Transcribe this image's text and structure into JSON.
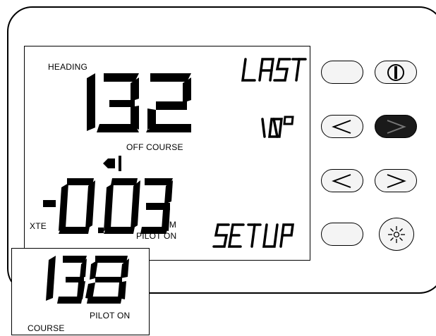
{
  "display": {
    "heading_label": "HEADING",
    "heading_value": "132",
    "top_right_text": "LAST",
    "mid_right_text": "10º",
    "off_course_label": "OFF COURSE",
    "xte_label": "XTE",
    "xte_value": "-0.03",
    "nm_label": "NM",
    "pilot_on_label": "PILOT  ON",
    "setup_text": "SETUP"
  },
  "inset": {
    "value": "138",
    "pilot_on_label": "PILOT ON",
    "course_label": "COURSE"
  },
  "buttons": [
    {
      "name": "blank-button-1",
      "icon": "none"
    },
    {
      "name": "power-button",
      "icon": "power-icon"
    },
    {
      "name": "left-arrow-button-1",
      "icon": "chevron-left-icon"
    },
    {
      "name": "right-arrow-button-1",
      "icon": "chevron-right-icon"
    },
    {
      "name": "left-arrow-button-2",
      "icon": "chevron-left-icon"
    },
    {
      "name": "right-arrow-button-2",
      "icon": "chevron-right-icon"
    },
    {
      "name": "blank-button-2",
      "icon": "none"
    },
    {
      "name": "backlight-button",
      "icon": "sun-icon"
    }
  ],
  "colors": {
    "ink": "#000000",
    "background": "#ffffff",
    "dark_key": "#1a1a1a"
  }
}
